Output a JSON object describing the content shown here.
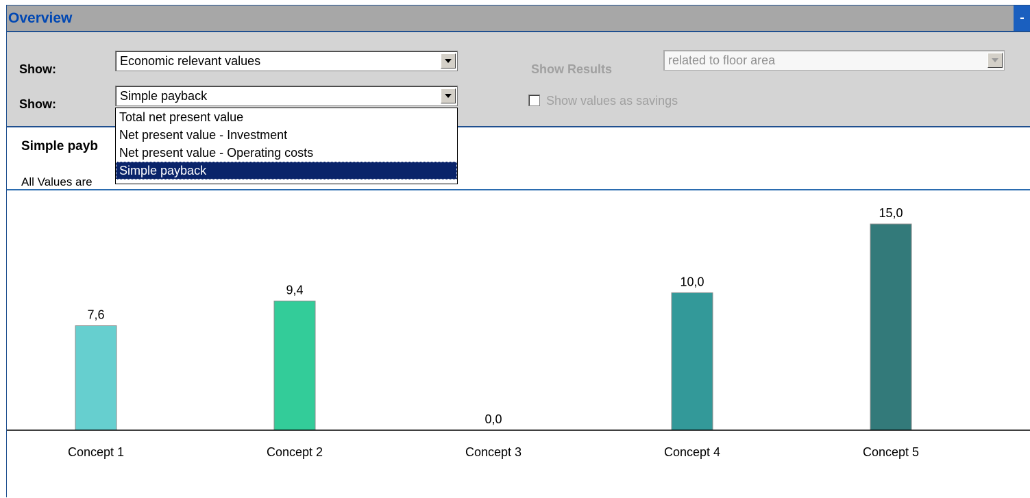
{
  "panel": {
    "title": "Overview",
    "collapse_label": "-"
  },
  "controls": {
    "show_label_1": "Show:",
    "show_label_2": "Show:",
    "combo1_value": "Economic relevant values",
    "combo2_value": "Simple payback",
    "show_results_label": "Show Results",
    "show_results_value": "related to floor area",
    "savings_label": "Show values as savings",
    "savings_checked": false
  },
  "dropdown": {
    "options": [
      "Total net present value",
      "Net present value - Investment",
      "Net present value - Operating costs",
      "Simple payback"
    ],
    "selected_index": 3
  },
  "content": {
    "heading_visible": "Simple payb",
    "subtext_visible": "All Values are"
  },
  "chart_data": {
    "type": "bar",
    "categories": [
      "Concept 1",
      "Concept 2",
      "Concept 3",
      "Concept 4",
      "Concept 5"
    ],
    "values": [
      7.6,
      9.4,
      0.0,
      10.0,
      15.0
    ],
    "value_labels": [
      "7,6",
      "9,4",
      "0,0",
      "10,0",
      "15,0"
    ],
    "colors": [
      "#66cfcf",
      "#33cc99",
      "#33aaaa",
      "#339999",
      "#337a7a"
    ],
    "ylim": [
      0,
      15
    ],
    "grid": false
  }
}
